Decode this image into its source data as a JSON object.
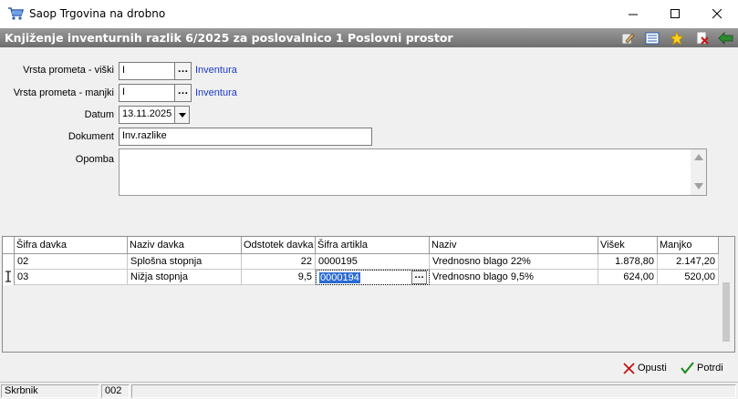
{
  "window": {
    "title": "Saop Trgovina na drobno"
  },
  "header": {
    "title": "Knjiženje inventurnih razlik 6/2025 za poslovalnico  1 Poslovni prostor"
  },
  "form": {
    "vrsta_visek_label": "Vrsta prometa - viški",
    "vrsta_visek_value": "I",
    "vrsta_visek_link": "Inventura",
    "vrsta_manjko_label": "Vrsta prometa - manjki",
    "vrsta_manjko_value": "I",
    "vrsta_manjko_link": "Inventura",
    "datum_label": "Datum",
    "datum_value": "13.11.2025",
    "dokument_label": "Dokument",
    "dokument_value": "Inv.razlike",
    "opomba_label": "Opomba",
    "opomba_value": ""
  },
  "grid": {
    "columns": [
      "Šifra davka",
      "Naziv davka",
      "Odstotek davka",
      "Šifra artikla",
      "Naziv",
      "Višek",
      "Manjko"
    ],
    "rows": [
      [
        "02",
        "Splošna stopnja",
        "22",
        "0000195",
        "Vrednosno blago 22%",
        "1.878,80",
        "2.147,20"
      ],
      [
        "03",
        "Nižja stopnja",
        "9,5",
        "0000194",
        "Vrednosno blago 9,5%",
        "624,00",
        "520,00"
      ]
    ]
  },
  "buttons": {
    "cancel": "Opusti",
    "confirm": "Potrdi"
  },
  "status": {
    "label": "Skrbnik",
    "value": "002"
  },
  "icons": {
    "edit": "edit-pencil-icon",
    "list": "list-icon",
    "favorite": "star-icon",
    "delete": "delete-doc-icon",
    "exit": "exit-icon"
  }
}
